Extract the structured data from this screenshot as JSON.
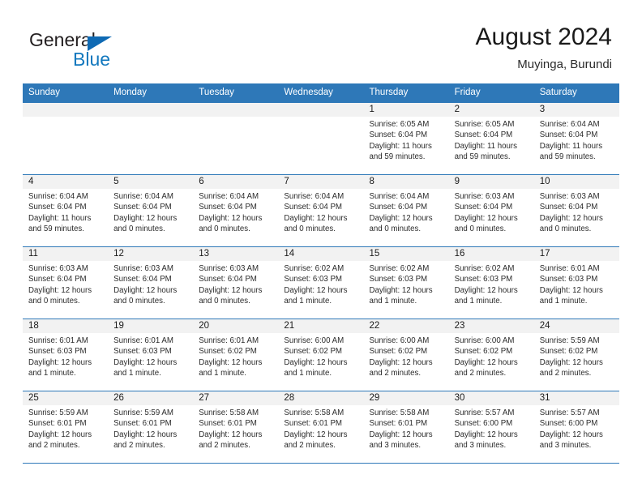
{
  "brand": {
    "name_top": "General",
    "name_bottom": "Blue",
    "accent_color": "#1278be",
    "triangle_color": "#0f6ab4"
  },
  "header": {
    "title": "August 2024",
    "subtitle": "Muyinga, Burundi"
  },
  "theme": {
    "header_row_bg": "#2e78b8",
    "day_strip_bg": "#f2f2f2",
    "row_divider": "#2e78b8",
    "text": "#2b2b2b"
  },
  "weekdays": [
    "Sunday",
    "Monday",
    "Tuesday",
    "Wednesday",
    "Thursday",
    "Friday",
    "Saturday"
  ],
  "weeks": [
    [
      {
        "day": "",
        "sunrise": "",
        "sunset": "",
        "daylight1": "",
        "daylight2": ""
      },
      {
        "day": "",
        "sunrise": "",
        "sunset": "",
        "daylight1": "",
        "daylight2": ""
      },
      {
        "day": "",
        "sunrise": "",
        "sunset": "",
        "daylight1": "",
        "daylight2": ""
      },
      {
        "day": "",
        "sunrise": "",
        "sunset": "",
        "daylight1": "",
        "daylight2": ""
      },
      {
        "day": "1",
        "sunrise": "Sunrise: 6:05 AM",
        "sunset": "Sunset: 6:04 PM",
        "daylight1": "Daylight: 11 hours",
        "daylight2": "and 59 minutes."
      },
      {
        "day": "2",
        "sunrise": "Sunrise: 6:05 AM",
        "sunset": "Sunset: 6:04 PM",
        "daylight1": "Daylight: 11 hours",
        "daylight2": "and 59 minutes."
      },
      {
        "day": "3",
        "sunrise": "Sunrise: 6:04 AM",
        "sunset": "Sunset: 6:04 PM",
        "daylight1": "Daylight: 11 hours",
        "daylight2": "and 59 minutes."
      }
    ],
    [
      {
        "day": "4",
        "sunrise": "Sunrise: 6:04 AM",
        "sunset": "Sunset: 6:04 PM",
        "daylight1": "Daylight: 11 hours",
        "daylight2": "and 59 minutes."
      },
      {
        "day": "5",
        "sunrise": "Sunrise: 6:04 AM",
        "sunset": "Sunset: 6:04 PM",
        "daylight1": "Daylight: 12 hours",
        "daylight2": "and 0 minutes."
      },
      {
        "day": "6",
        "sunrise": "Sunrise: 6:04 AM",
        "sunset": "Sunset: 6:04 PM",
        "daylight1": "Daylight: 12 hours",
        "daylight2": "and 0 minutes."
      },
      {
        "day": "7",
        "sunrise": "Sunrise: 6:04 AM",
        "sunset": "Sunset: 6:04 PM",
        "daylight1": "Daylight: 12 hours",
        "daylight2": "and 0 minutes."
      },
      {
        "day": "8",
        "sunrise": "Sunrise: 6:04 AM",
        "sunset": "Sunset: 6:04 PM",
        "daylight1": "Daylight: 12 hours",
        "daylight2": "and 0 minutes."
      },
      {
        "day": "9",
        "sunrise": "Sunrise: 6:03 AM",
        "sunset": "Sunset: 6:04 PM",
        "daylight1": "Daylight: 12 hours",
        "daylight2": "and 0 minutes."
      },
      {
        "day": "10",
        "sunrise": "Sunrise: 6:03 AM",
        "sunset": "Sunset: 6:04 PM",
        "daylight1": "Daylight: 12 hours",
        "daylight2": "and 0 minutes."
      }
    ],
    [
      {
        "day": "11",
        "sunrise": "Sunrise: 6:03 AM",
        "sunset": "Sunset: 6:04 PM",
        "daylight1": "Daylight: 12 hours",
        "daylight2": "and 0 minutes."
      },
      {
        "day": "12",
        "sunrise": "Sunrise: 6:03 AM",
        "sunset": "Sunset: 6:04 PM",
        "daylight1": "Daylight: 12 hours",
        "daylight2": "and 0 minutes."
      },
      {
        "day": "13",
        "sunrise": "Sunrise: 6:03 AM",
        "sunset": "Sunset: 6:04 PM",
        "daylight1": "Daylight: 12 hours",
        "daylight2": "and 0 minutes."
      },
      {
        "day": "14",
        "sunrise": "Sunrise: 6:02 AM",
        "sunset": "Sunset: 6:03 PM",
        "daylight1": "Daylight: 12 hours",
        "daylight2": "and 1 minute."
      },
      {
        "day": "15",
        "sunrise": "Sunrise: 6:02 AM",
        "sunset": "Sunset: 6:03 PM",
        "daylight1": "Daylight: 12 hours",
        "daylight2": "and 1 minute."
      },
      {
        "day": "16",
        "sunrise": "Sunrise: 6:02 AM",
        "sunset": "Sunset: 6:03 PM",
        "daylight1": "Daylight: 12 hours",
        "daylight2": "and 1 minute."
      },
      {
        "day": "17",
        "sunrise": "Sunrise: 6:01 AM",
        "sunset": "Sunset: 6:03 PM",
        "daylight1": "Daylight: 12 hours",
        "daylight2": "and 1 minute."
      }
    ],
    [
      {
        "day": "18",
        "sunrise": "Sunrise: 6:01 AM",
        "sunset": "Sunset: 6:03 PM",
        "daylight1": "Daylight: 12 hours",
        "daylight2": "and 1 minute."
      },
      {
        "day": "19",
        "sunrise": "Sunrise: 6:01 AM",
        "sunset": "Sunset: 6:03 PM",
        "daylight1": "Daylight: 12 hours",
        "daylight2": "and 1 minute."
      },
      {
        "day": "20",
        "sunrise": "Sunrise: 6:01 AM",
        "sunset": "Sunset: 6:02 PM",
        "daylight1": "Daylight: 12 hours",
        "daylight2": "and 1 minute."
      },
      {
        "day": "21",
        "sunrise": "Sunrise: 6:00 AM",
        "sunset": "Sunset: 6:02 PM",
        "daylight1": "Daylight: 12 hours",
        "daylight2": "and 1 minute."
      },
      {
        "day": "22",
        "sunrise": "Sunrise: 6:00 AM",
        "sunset": "Sunset: 6:02 PM",
        "daylight1": "Daylight: 12 hours",
        "daylight2": "and 2 minutes."
      },
      {
        "day": "23",
        "sunrise": "Sunrise: 6:00 AM",
        "sunset": "Sunset: 6:02 PM",
        "daylight1": "Daylight: 12 hours",
        "daylight2": "and 2 minutes."
      },
      {
        "day": "24",
        "sunrise": "Sunrise: 5:59 AM",
        "sunset": "Sunset: 6:02 PM",
        "daylight1": "Daylight: 12 hours",
        "daylight2": "and 2 minutes."
      }
    ],
    [
      {
        "day": "25",
        "sunrise": "Sunrise: 5:59 AM",
        "sunset": "Sunset: 6:01 PM",
        "daylight1": "Daylight: 12 hours",
        "daylight2": "and 2 minutes."
      },
      {
        "day": "26",
        "sunrise": "Sunrise: 5:59 AM",
        "sunset": "Sunset: 6:01 PM",
        "daylight1": "Daylight: 12 hours",
        "daylight2": "and 2 minutes."
      },
      {
        "day": "27",
        "sunrise": "Sunrise: 5:58 AM",
        "sunset": "Sunset: 6:01 PM",
        "daylight1": "Daylight: 12 hours",
        "daylight2": "and 2 minutes."
      },
      {
        "day": "28",
        "sunrise": "Sunrise: 5:58 AM",
        "sunset": "Sunset: 6:01 PM",
        "daylight1": "Daylight: 12 hours",
        "daylight2": "and 2 minutes."
      },
      {
        "day": "29",
        "sunrise": "Sunrise: 5:58 AM",
        "sunset": "Sunset: 6:01 PM",
        "daylight1": "Daylight: 12 hours",
        "daylight2": "and 3 minutes."
      },
      {
        "day": "30",
        "sunrise": "Sunrise: 5:57 AM",
        "sunset": "Sunset: 6:00 PM",
        "daylight1": "Daylight: 12 hours",
        "daylight2": "and 3 minutes."
      },
      {
        "day": "31",
        "sunrise": "Sunrise: 5:57 AM",
        "sunset": "Sunset: 6:00 PM",
        "daylight1": "Daylight: 12 hours",
        "daylight2": "and 3 minutes."
      }
    ]
  ]
}
